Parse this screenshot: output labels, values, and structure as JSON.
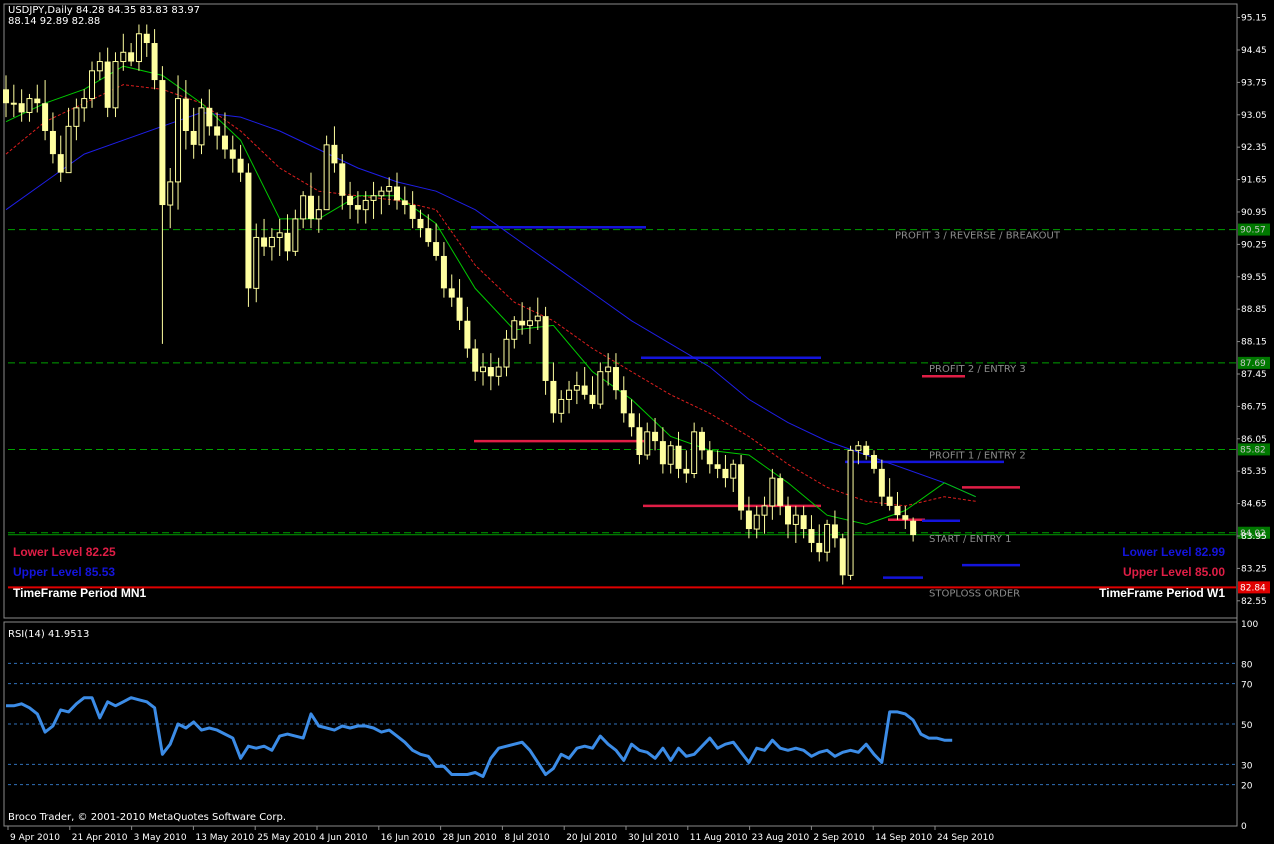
{
  "header": {
    "title": "USDJPY,Daily  84.28 84.35 83.83 83.97",
    "subtitle": "88.14 92.89 82.88"
  },
  "footer": {
    "copyright": "Broco Trader, © 2001-2010 MetaQuotes Software Corp."
  },
  "colors": {
    "candle": "#ffffa0",
    "ma_fast": "#00c800",
    "ma_mid": "#dc1e1e",
    "ma_slow": "#1e1ee6",
    "rsi": "#3c8ce6",
    "grid_dash": "#00a000",
    "red_level": "#e01e46",
    "blue_level": "#1414dc"
  },
  "chart_data": [
    {
      "type": "candlestick",
      "symbol": "USDJPY",
      "timeframe": "Daily",
      "ylim": [
        82.2,
        95.4
      ],
      "price_ticks": [
        95.15,
        94.45,
        93.75,
        93.05,
        92.35,
        91.65,
        90.95,
        90.25,
        89.55,
        88.85,
        88.15,
        87.45,
        86.75,
        86.05,
        85.35,
        84.65,
        83.95,
        83.25,
        82.55
      ],
      "date_ticks": [
        "9 Apr 2010",
        "21 Apr 2010",
        "3 May 2010",
        "13 May 2010",
        "25 May 2010",
        "4 Jun 2010",
        "16 Jun 2010",
        "28 Jun 2010",
        "8 Jul 2010",
        "20 Jul 2010",
        "30 Jul 2010",
        "11 Aug 2010",
        "23 Aug 2010",
        "2 Sep 2010",
        "14 Sep 2010",
        "24 Sep 2010"
      ],
      "candles": [
        [
          93.6,
          93.9,
          93.0,
          93.3
        ],
        [
          93.3,
          93.7,
          93.0,
          93.3
        ],
        [
          93.3,
          93.6,
          92.9,
          93.1
        ],
        [
          93.1,
          93.5,
          92.9,
          93.4
        ],
        [
          93.4,
          93.7,
          93.1,
          93.3
        ],
        [
          93.3,
          93.8,
          92.5,
          92.7
        ],
        [
          92.7,
          93.1,
          92.0,
          92.2
        ],
        [
          92.2,
          92.6,
          91.6,
          91.8
        ],
        [
          91.8,
          93.2,
          91.8,
          92.8
        ],
        [
          92.8,
          93.4,
          92.5,
          93.2
        ],
        [
          93.2,
          93.6,
          92.9,
          93.4
        ],
        [
          93.4,
          94.2,
          93.2,
          94.0
        ],
        [
          94.0,
          94.4,
          93.8,
          94.2
        ],
        [
          94.2,
          94.5,
          93.0,
          93.2
        ],
        [
          93.2,
          94.4,
          93.0,
          94.2
        ],
        [
          94.2,
          94.8,
          94.0,
          94.4
        ],
        [
          94.4,
          94.6,
          94.1,
          94.2
        ],
        [
          94.2,
          95.0,
          94.0,
          94.8
        ],
        [
          94.8,
          95.0,
          94.3,
          94.6
        ],
        [
          94.6,
          94.9,
          93.6,
          93.8
        ],
        [
          93.8,
          94.1,
          88.1,
          91.1
        ],
        [
          91.1,
          91.9,
          90.6,
          91.6
        ],
        [
          91.6,
          93.9,
          91.0,
          93.4
        ],
        [
          93.4,
          93.8,
          92.3,
          92.7
        ],
        [
          92.7,
          93.2,
          92.1,
          92.4
        ],
        [
          92.4,
          93.4,
          92.2,
          93.2
        ],
        [
          93.2,
          93.6,
          92.6,
          92.8
        ],
        [
          92.8,
          93.1,
          92.3,
          92.6
        ],
        [
          92.6,
          93.1,
          92.1,
          92.3
        ],
        [
          92.3,
          92.6,
          91.8,
          92.1
        ],
        [
          92.1,
          92.4,
          91.6,
          91.8
        ],
        [
          91.8,
          92.0,
          88.9,
          89.3
        ],
        [
          89.3,
          90.7,
          89.0,
          90.4
        ],
        [
          90.4,
          90.8,
          90.0,
          90.2
        ],
        [
          90.2,
          90.6,
          89.9,
          90.4
        ],
        [
          90.4,
          90.8,
          90.0,
          90.5
        ],
        [
          90.5,
          90.9,
          89.9,
          90.1
        ],
        [
          90.1,
          91.0,
          90.0,
          90.8
        ],
        [
          90.8,
          91.4,
          90.6,
          91.3
        ],
        [
          91.3,
          91.8,
          90.6,
          90.8
        ],
        [
          90.8,
          91.3,
          90.5,
          91.0
        ],
        [
          91.0,
          92.6,
          91.0,
          92.4
        ],
        [
          92.4,
          92.8,
          91.8,
          92.0
        ],
        [
          92.0,
          92.2,
          91.0,
          91.3
        ],
        [
          91.3,
          91.6,
          90.8,
          91.1
        ],
        [
          91.1,
          91.4,
          90.7,
          91.0
        ],
        [
          91.0,
          91.4,
          90.7,
          91.2
        ],
        [
          91.2,
          91.6,
          90.8,
          91.3
        ],
        [
          91.3,
          91.5,
          90.9,
          91.4
        ],
        [
          91.4,
          91.7,
          91.1,
          91.5
        ],
        [
          91.5,
          91.8,
          91.0,
          91.2
        ],
        [
          91.2,
          91.5,
          90.9,
          91.1
        ],
        [
          91.1,
          91.4,
          90.6,
          90.8
        ],
        [
          90.8,
          91.0,
          90.4,
          90.6
        ],
        [
          90.6,
          90.9,
          90.2,
          90.3
        ],
        [
          90.3,
          90.7,
          89.9,
          90.0
        ],
        [
          90.0,
          90.3,
          89.1,
          89.3
        ],
        [
          89.3,
          89.6,
          88.9,
          89.1
        ],
        [
          89.1,
          89.5,
          88.4,
          88.6
        ],
        [
          88.6,
          88.9,
          87.8,
          88.0
        ],
        [
          88.0,
          88.2,
          87.3,
          87.5
        ],
        [
          87.5,
          87.9,
          87.2,
          87.6
        ],
        [
          87.6,
          87.9,
          87.1,
          87.4
        ],
        [
          87.4,
          87.8,
          87.2,
          87.6
        ],
        [
          87.6,
          88.4,
          87.4,
          88.2
        ],
        [
          88.2,
          88.7,
          88.0,
          88.6
        ],
        [
          88.6,
          89.0,
          88.3,
          88.5
        ],
        [
          88.5,
          88.9,
          88.1,
          88.6
        ],
        [
          88.6,
          89.1,
          88.4,
          88.7
        ],
        [
          88.7,
          88.9,
          87.0,
          87.3
        ],
        [
          87.3,
          87.7,
          86.4,
          86.6
        ],
        [
          86.6,
          87.1,
          86.4,
          86.9
        ],
        [
          86.9,
          87.3,
          86.6,
          87.1
        ],
        [
          87.1,
          87.5,
          86.8,
          87.2
        ],
        [
          87.2,
          87.6,
          86.9,
          87.0
        ],
        [
          87.0,
          87.4,
          86.7,
          86.8
        ],
        [
          86.8,
          87.7,
          86.7,
          87.5
        ],
        [
          87.5,
          87.9,
          87.2,
          87.6
        ],
        [
          87.6,
          87.9,
          86.9,
          87.1
        ],
        [
          87.1,
          87.4,
          86.4,
          86.6
        ],
        [
          86.6,
          86.9,
          86.1,
          86.3
        ],
        [
          86.3,
          86.6,
          85.5,
          85.7
        ],
        [
          85.7,
          86.4,
          85.6,
          86.2
        ],
        [
          86.2,
          86.5,
          85.8,
          86.0
        ],
        [
          86.0,
          86.3,
          85.3,
          85.5
        ],
        [
          85.5,
          86.0,
          85.3,
          85.9
        ],
        [
          85.9,
          86.2,
          85.2,
          85.4
        ],
        [
          85.4,
          85.8,
          85.1,
          85.3
        ],
        [
          85.3,
          86.4,
          85.2,
          86.2
        ],
        [
          86.2,
          86.3,
          85.6,
          85.8
        ],
        [
          85.8,
          86.0,
          85.3,
          85.5
        ],
        [
          85.5,
          85.8,
          85.2,
          85.4
        ],
        [
          85.4,
          85.7,
          85.0,
          85.2
        ],
        [
          85.2,
          85.6,
          84.9,
          85.5
        ],
        [
          85.5,
          85.7,
          84.3,
          84.5
        ],
        [
          84.5,
          84.8,
          83.9,
          84.1
        ],
        [
          84.1,
          84.6,
          83.9,
          84.4
        ],
        [
          84.4,
          84.8,
          84.0,
          84.6
        ],
        [
          84.6,
          85.4,
          84.3,
          85.2
        ],
        [
          85.2,
          85.3,
          84.4,
          84.6
        ],
        [
          84.6,
          84.8,
          83.9,
          84.2
        ],
        [
          84.2,
          84.6,
          83.8,
          84.4
        ],
        [
          84.4,
          84.6,
          83.9,
          84.1
        ],
        [
          84.1,
          84.4,
          83.6,
          83.8
        ],
        [
          83.8,
          84.2,
          83.4,
          83.6
        ],
        [
          83.6,
          84.3,
          83.4,
          84.2
        ],
        [
          84.2,
          84.5,
          83.7,
          83.9
        ],
        [
          83.9,
          84.0,
          82.9,
          83.1
        ],
        [
          83.1,
          85.9,
          83.0,
          85.8
        ],
        [
          85.8,
          86.0,
          85.5,
          85.9
        ],
        [
          85.9,
          86.0,
          85.6,
          85.7
        ],
        [
          85.7,
          85.8,
          85.3,
          85.4
        ],
        [
          85.4,
          85.6,
          84.6,
          84.8
        ],
        [
          84.8,
          85.2,
          84.5,
          84.6
        ],
        [
          84.6,
          84.9,
          84.3,
          84.4
        ],
        [
          84.4,
          84.6,
          84.1,
          84.3
        ],
        [
          84.28,
          84.35,
          83.83,
          83.97
        ]
      ],
      "ma_slow": [
        [
          0,
          91.0
        ],
        [
          5,
          91.6
        ],
        [
          10,
          92.2
        ],
        [
          15,
          92.5
        ],
        [
          20,
          92.8
        ],
        [
          25,
          93.1
        ],
        [
          30,
          93.0
        ],
        [
          35,
          92.7
        ],
        [
          40,
          92.3
        ],
        [
          45,
          91.9
        ],
        [
          50,
          91.6
        ],
        [
          55,
          91.4
        ],
        [
          60,
          91.0
        ],
        [
          65,
          90.4
        ],
        [
          70,
          89.8
        ],
        [
          75,
          89.2
        ],
        [
          80,
          88.6
        ],
        [
          85,
          88.1
        ],
        [
          90,
          87.6
        ],
        [
          95,
          86.9
        ],
        [
          100,
          86.4
        ],
        [
          105,
          86.0
        ],
        [
          110,
          85.7
        ],
        [
          115,
          85.4
        ],
        [
          120,
          85.1
        ],
        [
          124,
          84.8
        ]
      ],
      "ma_mid": [
        [
          0,
          92.2
        ],
        [
          5,
          92.9
        ],
        [
          10,
          93.3
        ],
        [
          15,
          93.7
        ],
        [
          20,
          93.6
        ],
        [
          25,
          93.3
        ],
        [
          30,
          92.7
        ],
        [
          35,
          91.9
        ],
        [
          40,
          91.4
        ],
        [
          45,
          91.3
        ],
        [
          50,
          91.2
        ],
        [
          55,
          91.0
        ],
        [
          60,
          89.8
        ],
        [
          65,
          89.0
        ],
        [
          70,
          88.6
        ],
        [
          75,
          88.0
        ],
        [
          80,
          87.5
        ],
        [
          85,
          87.0
        ],
        [
          90,
          86.6
        ],
        [
          95,
          86.1
        ],
        [
          100,
          85.5
        ],
        [
          105,
          85.0
        ],
        [
          110,
          84.7
        ],
        [
          115,
          84.6
        ],
        [
          120,
          84.8
        ],
        [
          124,
          84.7
        ]
      ],
      "ma_fast": [
        [
          0,
          92.9
        ],
        [
          5,
          93.3
        ],
        [
          10,
          93.6
        ],
        [
          15,
          94.1
        ],
        [
          20,
          93.9
        ],
        [
          25,
          93.3
        ],
        [
          30,
          92.5
        ],
        [
          35,
          90.8
        ],
        [
          40,
          90.8
        ],
        [
          45,
          91.3
        ],
        [
          50,
          91.3
        ],
        [
          55,
          90.7
        ],
        [
          60,
          89.3
        ],
        [
          65,
          88.4
        ],
        [
          70,
          88.5
        ],
        [
          75,
          87.5
        ],
        [
          80,
          86.9
        ],
        [
          85,
          86.1
        ],
        [
          90,
          85.8
        ],
        [
          95,
          85.7
        ],
        [
          100,
          85.1
        ],
        [
          105,
          84.4
        ],
        [
          110,
          84.2
        ],
        [
          115,
          84.5
        ],
        [
          120,
          85.1
        ],
        [
          124,
          84.8
        ]
      ],
      "levels": [
        {
          "text": "PROFIT 3 / REVERSE / BREAKOUT",
          "price": 90.57,
          "tag": "90.57",
          "color": "#007800"
        },
        {
          "text": "PROFIT 2 / ENTRY 3",
          "price": 87.69,
          "tag": "87.69",
          "color": "#007800"
        },
        {
          "text": "PROFIT 1 / ENTRY 2",
          "price": 85.82,
          "tag": "85.82",
          "color": "#007800"
        },
        {
          "text": "START  / ENTRY 1",
          "price": 84.02,
          "tag": "84.02",
          "color": "#007800"
        },
        {
          "text": "STOPLOSS ORDER",
          "price": 82.84,
          "tag": "82.84",
          "color": "#e00000"
        }
      ],
      "segments": [
        {
          "x0": 471,
          "x1": 646,
          "price": 90.62,
          "color": "#1414dc"
        },
        {
          "x0": 641,
          "x1": 821,
          "price": 87.8,
          "color": "#1414dc"
        },
        {
          "x0": 474,
          "x1": 644,
          "price": 86.0,
          "color": "#e01e46"
        },
        {
          "x0": 643,
          "x1": 821,
          "price": 84.6,
          "color": "#e01e46"
        },
        {
          "x0": 845,
          "x1": 1004,
          "price": 85.55,
          "color": "#1414dc"
        },
        {
          "x0": 962,
          "x1": 1020,
          "price": 85.0,
          "color": "#e01e46"
        },
        {
          "x0": 922,
          "x1": 965,
          "price": 87.4,
          "color": "#e01e46"
        },
        {
          "x0": 962,
          "x1": 1020,
          "price": 83.32,
          "color": "#1414dc"
        },
        {
          "x0": 883,
          "x1": 923,
          "price": 83.05,
          "color": "#1414dc"
        },
        {
          "x0": 888,
          "x1": 925,
          "price": 84.3,
          "color": "#e01e46"
        },
        {
          "x0": 922,
          "x1": 960,
          "price": 84.28,
          "color": "#1414dc"
        }
      ],
      "left_labels": [
        {
          "text": "Lower Level 82.25",
          "color": "#e01e46"
        },
        {
          "text": "Upper Level 85.53",
          "color": "#1414dc"
        },
        {
          "text": "TimeFrame Period MN1",
          "color": "#ffffff"
        }
      ],
      "right_labels": [
        {
          "text": "Lower Level 82.99",
          "color": "#1414dc"
        },
        {
          "text": "Upper Level 85.00",
          "color": "#e01e46"
        },
        {
          "text": "TimeFrame Period W1",
          "color": "#ffffff"
        }
      ]
    },
    {
      "type": "line",
      "title": "RSI(14) 41.9513",
      "ylim": [
        0,
        100
      ],
      "ticks": [
        100,
        80,
        70,
        50,
        30,
        20,
        0
      ],
      "dashed_levels": [
        80,
        70,
        50,
        30,
        20
      ],
      "values": [
        59,
        59,
        60,
        58,
        55,
        46,
        49,
        57,
        56,
        60,
        63,
        63,
        53,
        61,
        59,
        61,
        63,
        62,
        61,
        58,
        35,
        40,
        50,
        48,
        51,
        47,
        48,
        47,
        45,
        43,
        33,
        39,
        38,
        39,
        37,
        44,
        45,
        44,
        43,
        55,
        49,
        48,
        47,
        49,
        48,
        49,
        49,
        48,
        46,
        47,
        44,
        41,
        37,
        35,
        34,
        29,
        29,
        25,
        25,
        25,
        26,
        24,
        33,
        38,
        39,
        40,
        41,
        37,
        31,
        25,
        28,
        35,
        33,
        38,
        39,
        38,
        44,
        40,
        37,
        32,
        40,
        37,
        36,
        33,
        38,
        32,
        38,
        34,
        35,
        39,
        43,
        38,
        40,
        41,
        36,
        31,
        38,
        37,
        42,
        38,
        37,
        38,
        37,
        34,
        36,
        37,
        34,
        36,
        37,
        36,
        40,
        35,
        31,
        56,
        56,
        55,
        52,
        45,
        43,
        43,
        42,
        42
      ]
    }
  ]
}
